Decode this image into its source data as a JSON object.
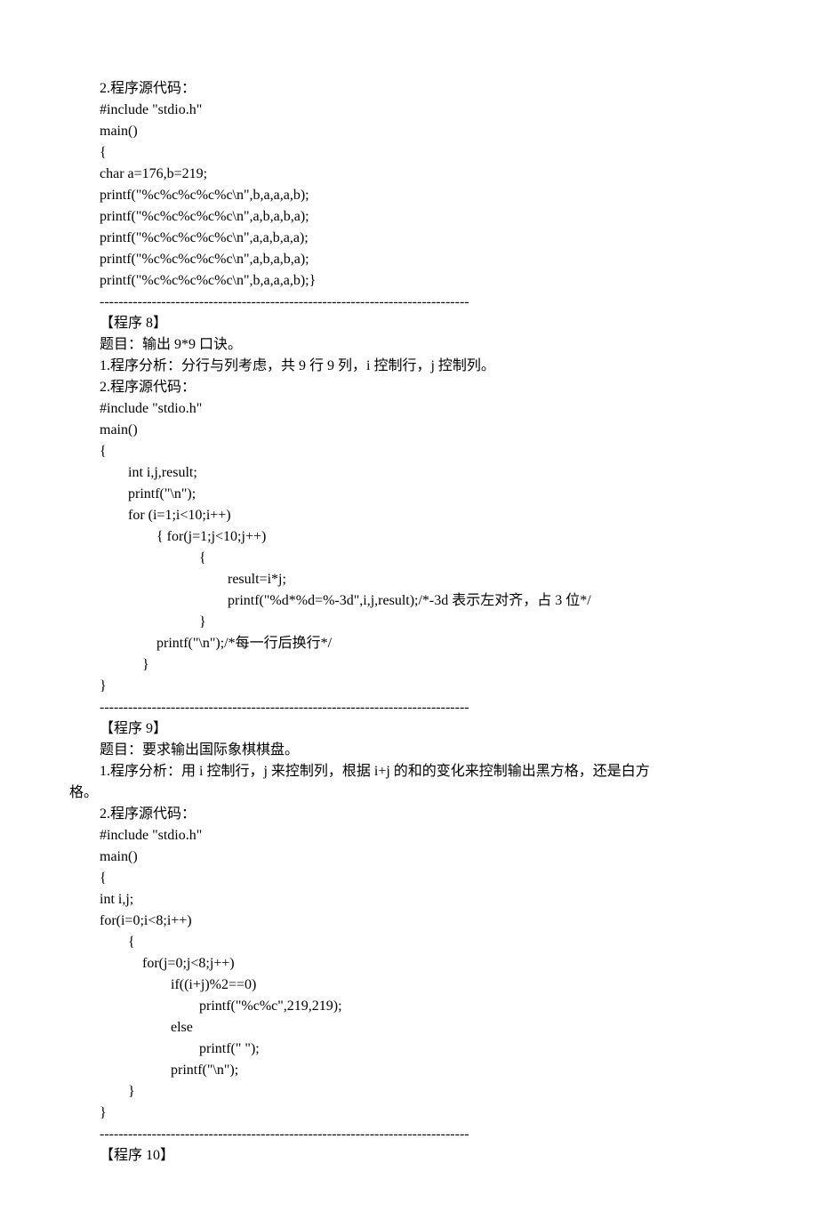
{
  "lines": [
    "2.程序源代码：",
    "#include \"stdio.h\"",
    "main()",
    "{",
    "char a=176,b=219;",
    "printf(\"%c%c%c%c%c\\n\",b,a,a,a,b);",
    "printf(\"%c%c%c%c%c\\n\",a,b,a,b,a);",
    "printf(\"%c%c%c%c%c\\n\",a,a,b,a,a);",
    "printf(\"%c%c%c%c%c\\n\",a,b,a,b,a);",
    "printf(\"%c%c%c%c%c\\n\",b,a,a,a,b);}",
    "------------------------------------------------------------------------------",
    "【程序 8】",
    "题目：输出 9*9 口诀。",
    "1.程序分析：分行与列考虑，共 9 行 9 列，i 控制行，j 控制列。",
    "2.程序源代码：",
    "#include \"stdio.h\"",
    "main()",
    "{",
    "　　int i,j,result;",
    "　　printf(\"\\n\");",
    "　　for (i=1;i<10;i++)",
    "　　　　{ for(j=1;j<10;j++)",
    "　　　　　　　{",
    "　　　　　　　　　result=i*j;",
    "　　　　　　　　　printf(\"%d*%d=%-3d\",i,j,result);/*-3d 表示左对齐，占 3 位*/",
    "　　　　　　　}",
    "　　　　printf(\"\\n\");/*每一行后换行*/",
    "　　　}",
    "}",
    "------------------------------------------------------------------------------",
    "【程序 9】",
    "题目：要求输出国际象棋棋盘。",
    "1.程序分析：用 i 控制行，j 来控制列，根据 i+j 的和的变化来控制输出黑方格，还是白方",
    "2.程序源代码：",
    "#include \"stdio.h\"",
    "main()",
    "{",
    "int i,j;",
    "for(i=0;i<8;i++)",
    "　　{",
    "　　　for(j=0;j<8;j++)",
    "　　　　　if((i+j)%2==0)",
    "　　　　　　　printf(\"%c%c\",219,219);",
    "　　　　　else",
    "　　　　　　　printf(\" \");",
    "　　　　　printf(\"\\n\");",
    "　　}",
    "}",
    "------------------------------------------------------------------------------",
    "【程序 10】"
  ],
  "ge_label": "格。"
}
